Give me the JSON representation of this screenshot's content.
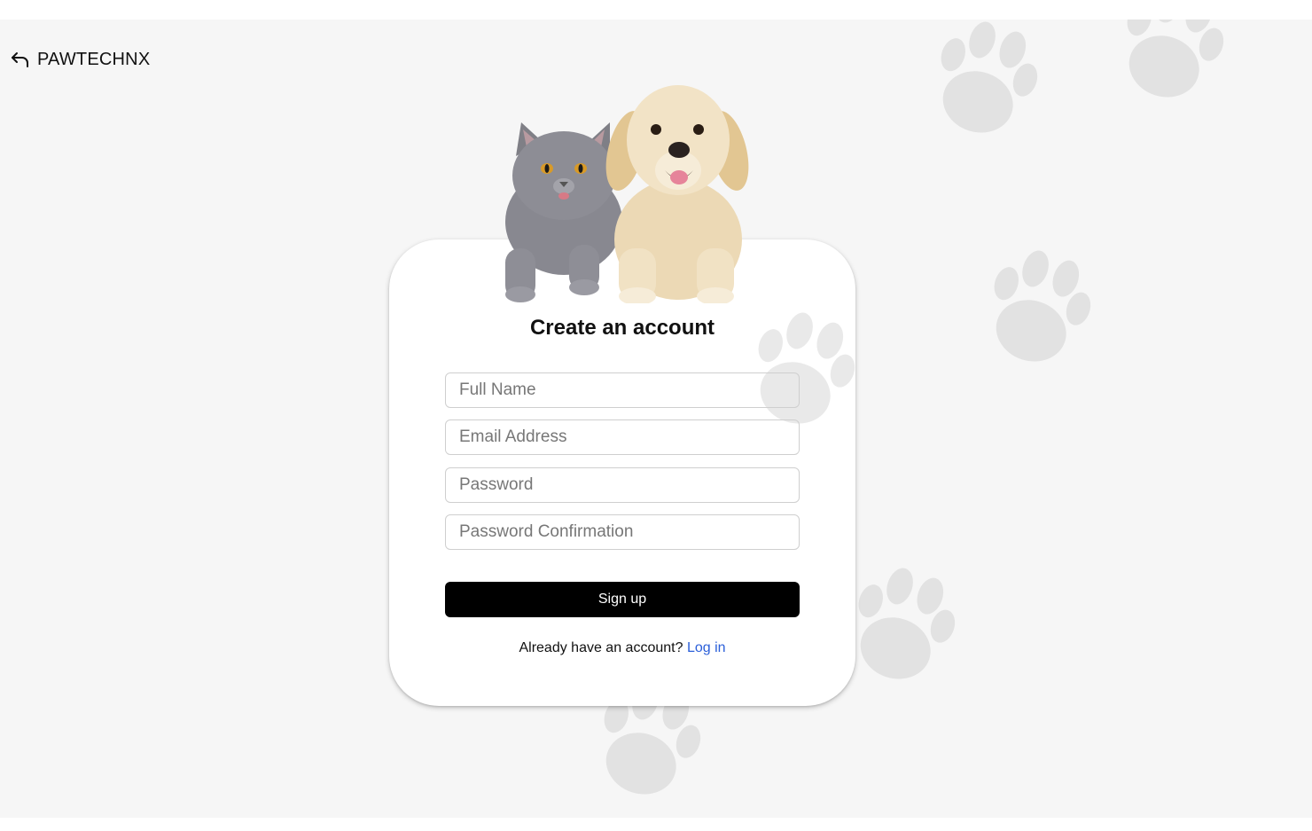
{
  "brand": {
    "name": "PAWTECHNX",
    "icon": "back-arrow-icon"
  },
  "signup_form": {
    "title": "Create an account",
    "fields": {
      "full_name": {
        "placeholder": "Full Name",
        "value": ""
      },
      "email": {
        "placeholder": "Email Address",
        "value": ""
      },
      "password": {
        "placeholder": "Password",
        "value": ""
      },
      "password_confirmation": {
        "placeholder": "Password Confirmation",
        "value": ""
      }
    },
    "submit_label": "Sign up",
    "login_prompt": "Already have an account?",
    "login_link": "Log in"
  },
  "decor": {
    "illustration": "cat-and-dog-illustration",
    "background_pattern": "paw-print-icon"
  },
  "colors": {
    "page_background": "#f6f6f6",
    "card_background": "#ffffff",
    "primary_button": "#000000",
    "link": "#2b5fd9",
    "paw_print": "#e2e2e2"
  }
}
